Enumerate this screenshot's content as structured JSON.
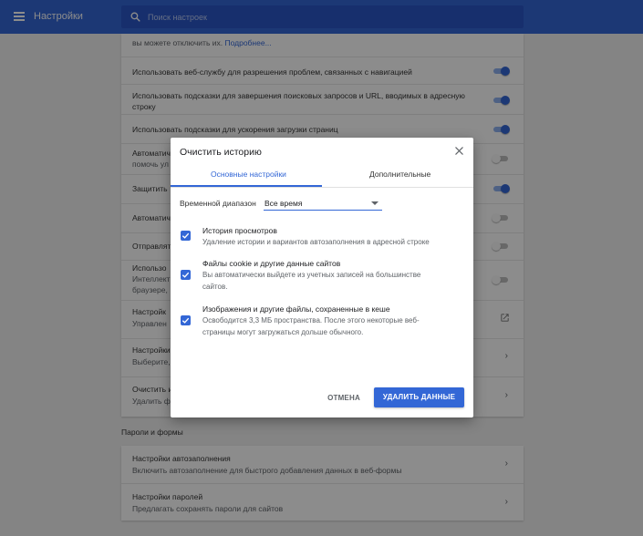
{
  "header": {
    "title": "Настройки",
    "search_placeholder": "Поиск настроек"
  },
  "settings": {
    "top_partial": "вы можете отключить их.",
    "top_partial_link": "Подробнее...",
    "rows": [
      {
        "title": "Использовать веб-службу для разрешения проблем, связанных с навигацией",
        "toggle": "on"
      },
      {
        "title": "Использовать подсказки для завершения поисковых запросов и URL, вводимых в адресную",
        "title2": "строку",
        "toggle": "on"
      },
      {
        "title": "Использовать подсказки для ускорения загрузки страниц",
        "toggle": "on"
      },
      {
        "title": "Автоматич",
        "desc": "помочь ул",
        "toggle": "off"
      },
      {
        "title": "Защитить",
        "toggle": "on"
      },
      {
        "title": "Автоматич",
        "toggle": "off"
      },
      {
        "title": "Отправлят",
        "toggle": "off"
      },
      {
        "title": "Использо",
        "desc": "Интеллект",
        "desc2": "браузере, ",
        "toggle": "off"
      },
      {
        "title": "Настройк",
        "desc": "Управлен"
      },
      {
        "title": "Настройки",
        "desc": "Выберите,"
      },
      {
        "title": "Очистить и",
        "desc": "Удалить ф"
      }
    ]
  },
  "passwords_section": {
    "label": "Пароли и формы",
    "rows": [
      {
        "title": "Настройки автозаполнения",
        "desc": "Включить автозаполнение для быстрого добавления данных в веб-формы"
      },
      {
        "title": "Настройки паролей",
        "desc": "Предлагать сохранять пароли для сайтов"
      }
    ]
  },
  "dialog": {
    "title": "Очистить историю",
    "tabs": [
      "Основные настройки",
      "Дополнительные"
    ],
    "active_tab": 0,
    "time_range_label": "Временной диапазон",
    "time_range_value": "Все время",
    "options": [
      {
        "title": "История просмотров",
        "desc": "Удаление истории и вариантов автозаполнения в адресной строке",
        "checked": true
      },
      {
        "title": "Файлы cookie и другие данные сайтов",
        "desc": "Вы автоматически выйдете из учетных записей на большинстве",
        "desc2": "сайтов.",
        "checked": true
      },
      {
        "title": "Изображения и другие файлы, сохраненные в кеше",
        "desc": "Освободится 3,3 МБ пространства. После этого некоторые веб-",
        "desc2": "страницы могут загружаться дольше обычного.",
        "checked": true
      }
    ],
    "cancel_label": "ОТМЕНА",
    "delete_label": "УДАЛИТЬ ДАННЫЕ"
  },
  "colors": {
    "accent": "#3367d6",
    "header_bg": "#3367d6",
    "page_bg": "#f1f1f1"
  },
  "icons": [
    "menu-icon",
    "search-icon",
    "close-icon",
    "checkbox-checked-icon",
    "chevron-right-icon",
    "open-in-new-icon"
  ]
}
